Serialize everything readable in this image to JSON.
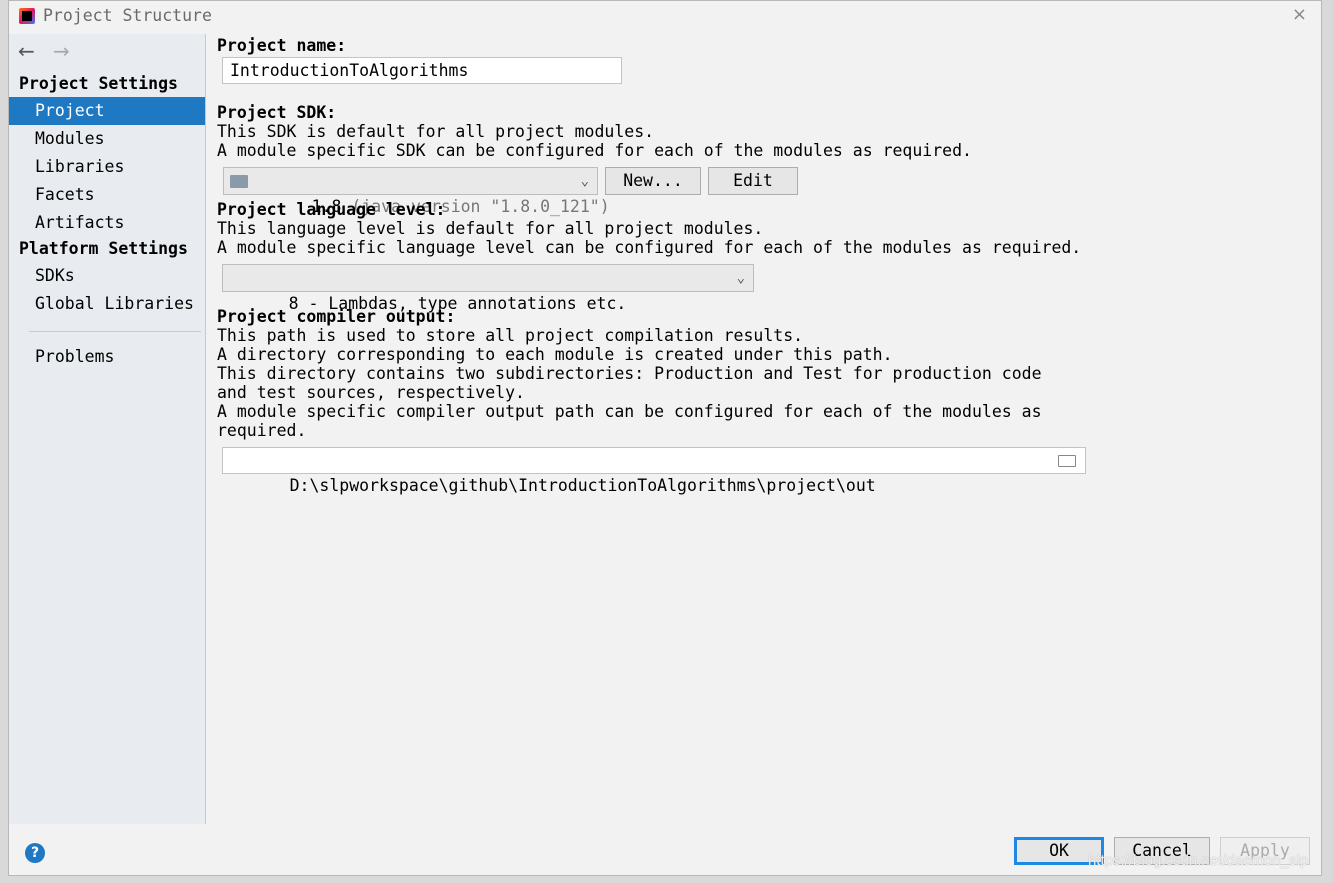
{
  "window": {
    "title": "Project Structure",
    "close": "×"
  },
  "sidebar": {
    "back": "←",
    "forward": "→",
    "project_settings": "Project Settings",
    "items": [
      "Project",
      "Modules",
      "Libraries",
      "Facets",
      "Artifacts"
    ],
    "platform_settings": "Platform Settings",
    "platform_items": [
      "SDKs",
      "Global Libraries"
    ],
    "problems": "Problems"
  },
  "main": {
    "name_label": "Project name:",
    "name_value": "IntroductionToAlgorithms",
    "sdk_label": "Project SDK:",
    "sdk_desc1": "This SDK is default for all project modules.",
    "sdk_desc2": "A module specific SDK can be configured for each of the modules as required.",
    "sdk_version": "1.8",
    "sdk_detail": " (java version \"1.8.0_121\")",
    "new_button": "New...",
    "edit_button": "Edit",
    "lang_label": "Project language level:",
    "lang_desc1": "This language level is default for all project modules.",
    "lang_desc2": "A module specific language level can be configured for each of the modules as required.",
    "lang_value": "8 - Lambdas, type annotations etc.",
    "out_label": "Project compiler output:",
    "out_desc": "This path is used to store all project compilation results.\nA directory corresponding to each module is created under this path.\nThis directory contains two subdirectories: Production and Test for production code\nand test sources, respectively.\nA module specific compiler output path can be configured for each of the modules as\nrequired.",
    "out_value": "D:\\slpworkspace\\github\\IntroductionToAlgorithms\\project\\out"
  },
  "footer": {
    "help": "?",
    "ok": "OK",
    "cancel": "Cancel",
    "apply": "Apply"
  },
  "watermark": "https://blog.csdn.net/daemon_slp",
  "colors": {
    "accent": "#1e78c2"
  }
}
